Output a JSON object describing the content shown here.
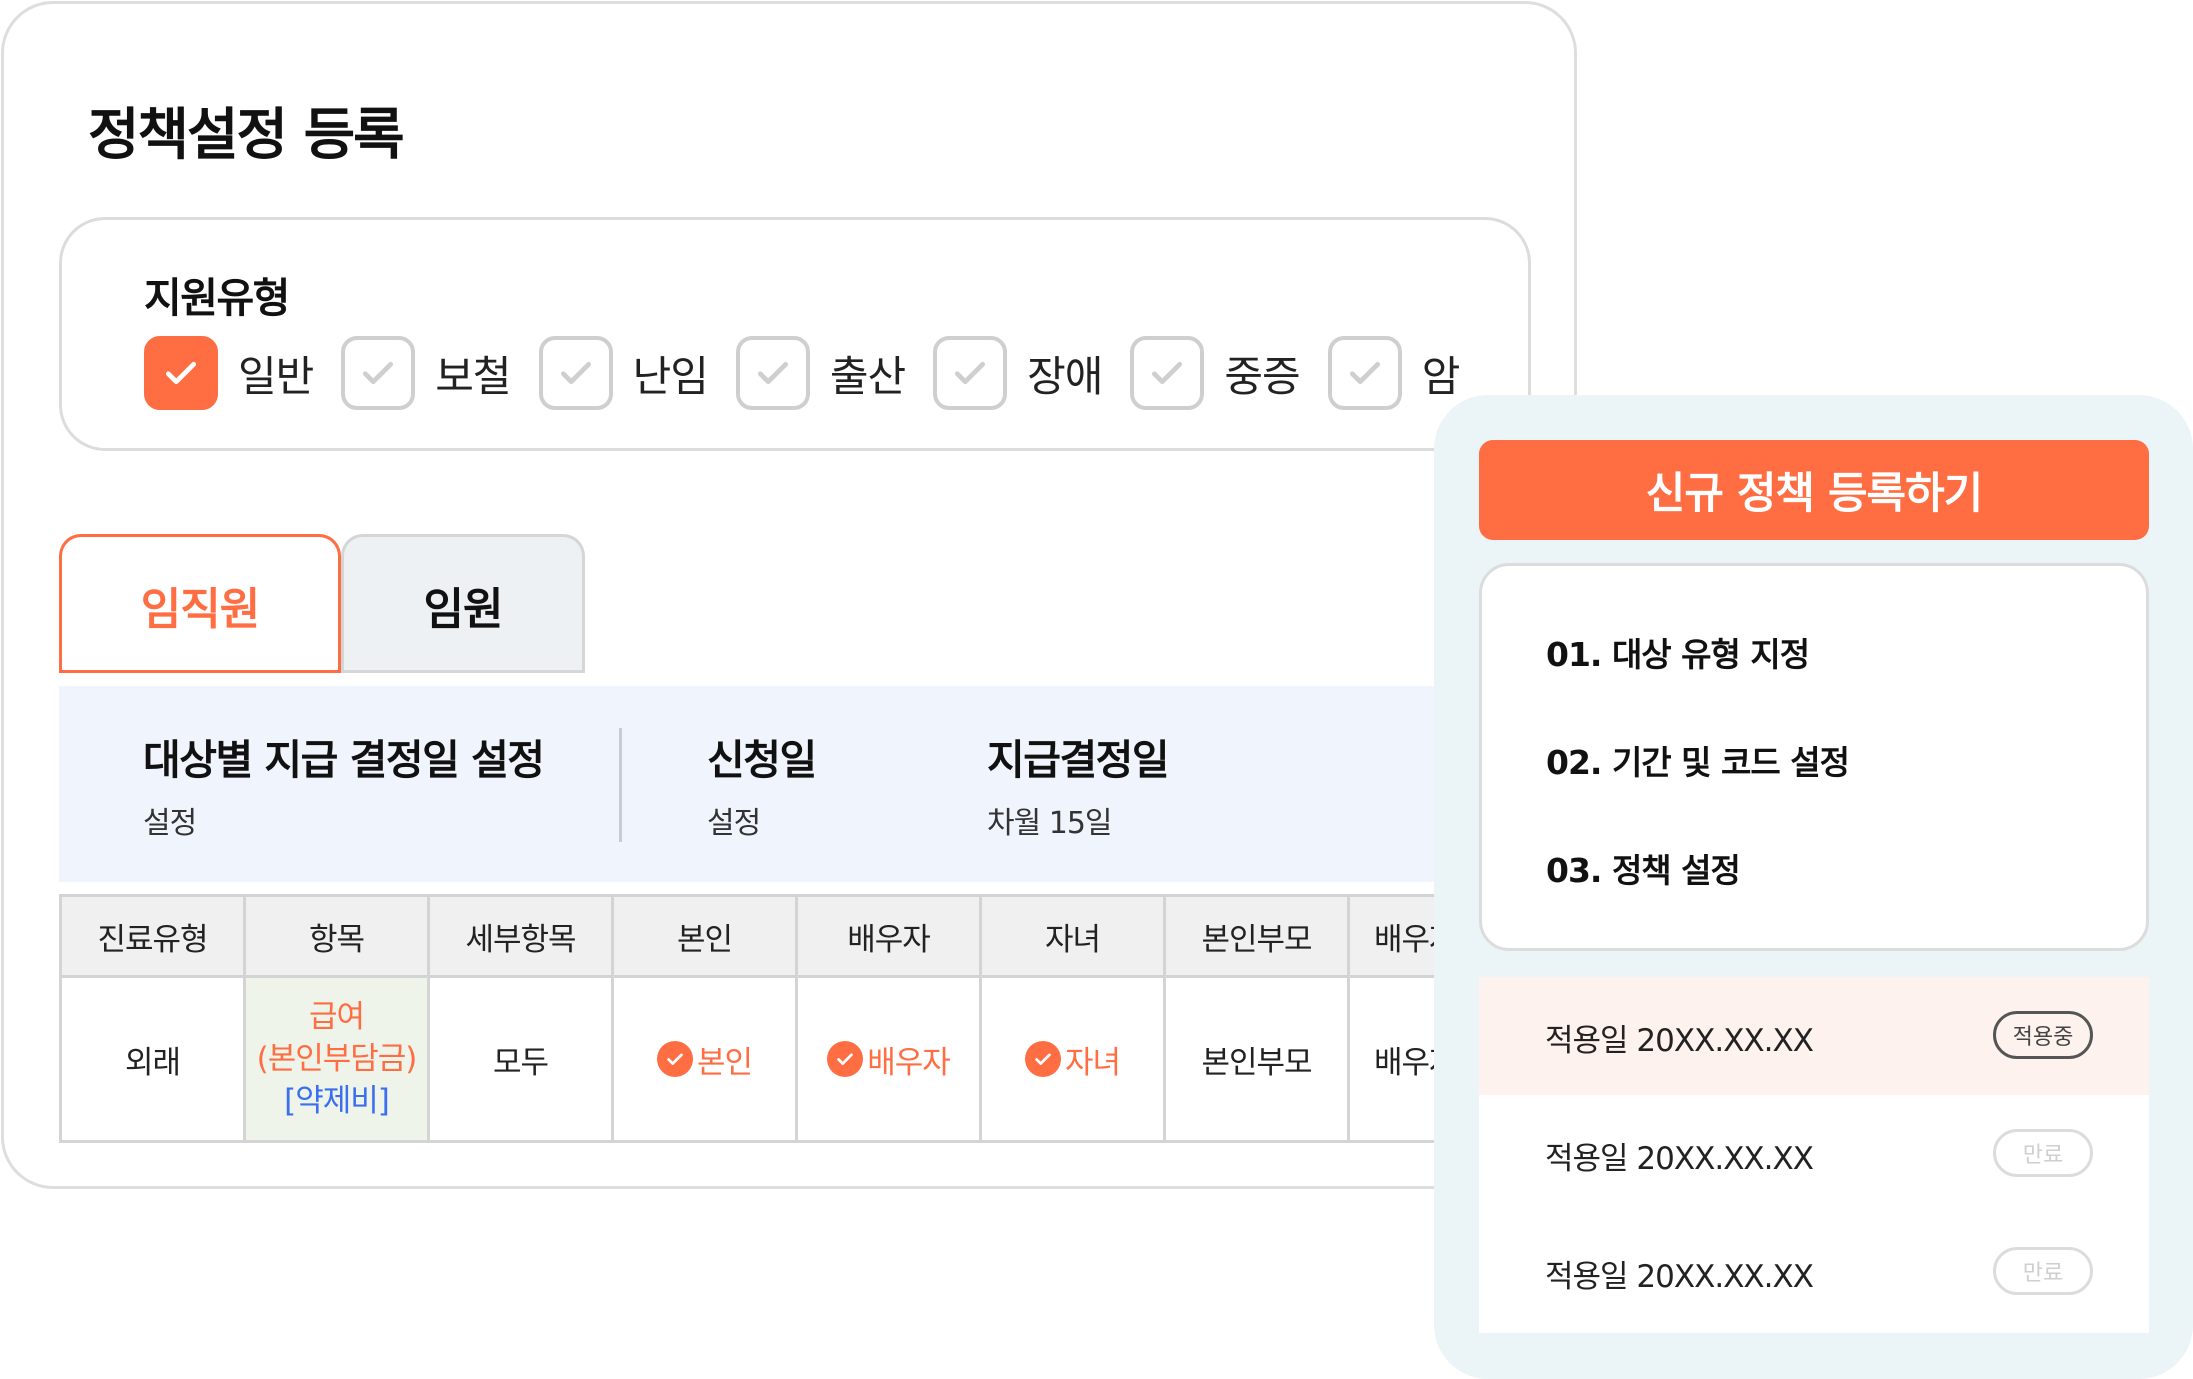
{
  "page": {
    "title": "정책설정 등록"
  },
  "support_type": {
    "label": "지원유형",
    "options": [
      {
        "label": "일반",
        "checked": true
      },
      {
        "label": "보철",
        "checked": false
      },
      {
        "label": "난임",
        "checked": false
      },
      {
        "label": "출산",
        "checked": false
      },
      {
        "label": "장애",
        "checked": false
      },
      {
        "label": "중증",
        "checked": false
      },
      {
        "label": "암",
        "checked": false
      }
    ]
  },
  "tabs": [
    {
      "label": "임직원",
      "active": true
    },
    {
      "label": "임원",
      "active": false
    }
  ],
  "info": {
    "target_title": "대상별 지급 결정일 설정",
    "target_value": "설정",
    "apply_title": "신청일",
    "apply_value": "설정",
    "decision_title": "지급결정일",
    "decision_value": "차월 15일"
  },
  "table": {
    "headers": [
      "진료유형",
      "항목",
      "세부항목",
      "본인",
      "배우자",
      "자녀",
      "본인부모",
      "배우자"
    ],
    "row": {
      "care_type": "외래",
      "item_line1": "급여",
      "item_line2": "(본인부담금)",
      "item_line3": "[약제비]",
      "sub_item": "모두",
      "self": "본인",
      "spouse": "배우자",
      "child": "자녀",
      "parents": "본인부모",
      "spouse_parents": "배우자"
    }
  },
  "side_panel": {
    "button_label": "신규 정책 등록하기",
    "steps": [
      "01. 대상 유형 지정",
      "02. 기간 및 코드 설정",
      "03. 정책 설정"
    ],
    "history": [
      {
        "date": "적용일 20XX.XX.XX",
        "status": "적용중"
      },
      {
        "date": "적용일 20XX.XX.XX",
        "status": "만료"
      },
      {
        "date": "적용일 20XX.XX.XX",
        "status": "만료"
      }
    ]
  },
  "colors": {
    "accent": "#ff6d42",
    "link_blue": "#3a6ff0",
    "panel_blue": "#f0f5fd",
    "side_bg": "#ebf4f6"
  }
}
